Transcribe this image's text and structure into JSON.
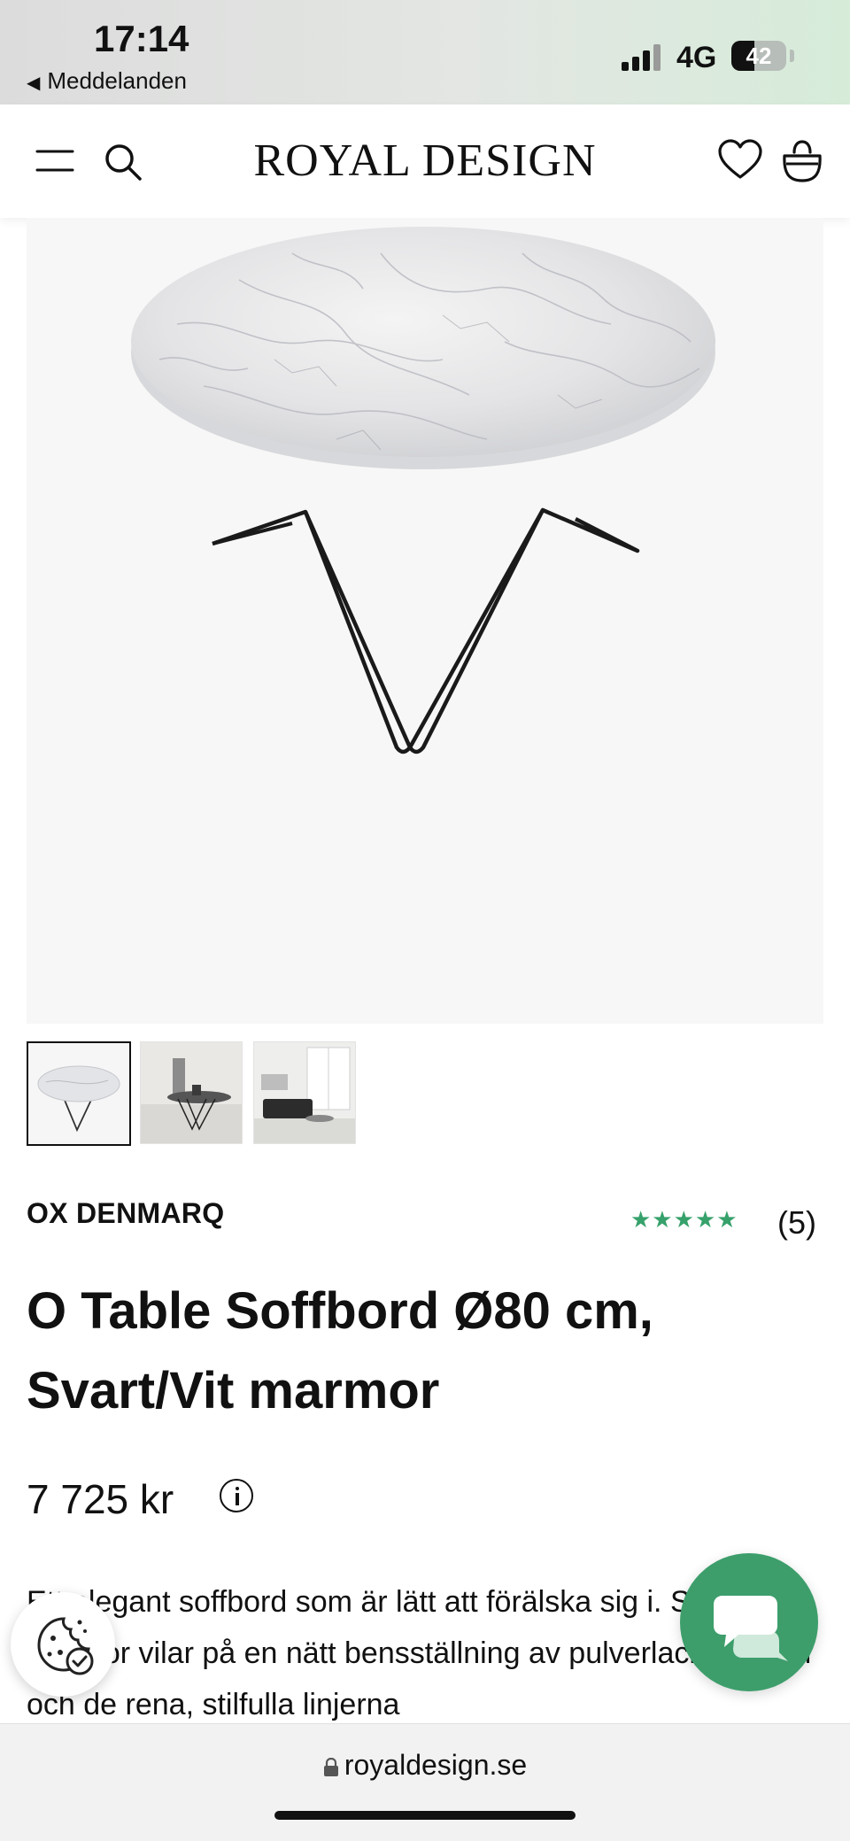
{
  "status_bar": {
    "time": "17:14",
    "back_label": "Meddelanden",
    "network": "4G",
    "battery": "42",
    "battery_fraction": 0.42
  },
  "header": {
    "logo": "ROYAL DESIGN",
    "icons": [
      "menu-icon",
      "search-icon",
      "heart-icon",
      "bag-icon"
    ]
  },
  "product": {
    "brand": "OX DENMARQ",
    "rating_stars": "★★★★★",
    "rating_value": 5,
    "rating_count": "(5)",
    "title": "O Table Soffbord Ø80 cm, Svart/Vit marmor",
    "price": "7 725 kr",
    "description": "Ett elegant soffbord som är lätt att förälska sig i. Skivan av marmor vilar på en nätt bensställning av pulverlackerat stål och de rena, stilfulla linjerna",
    "thumbnails": [
      "table-marble-thumb",
      "table-room-thumb",
      "living-room-thumb"
    ]
  },
  "browser": {
    "url": "royaldesign.se"
  },
  "colors": {
    "accent_green": "#3d9e6b",
    "star_green": "#36a16b"
  }
}
